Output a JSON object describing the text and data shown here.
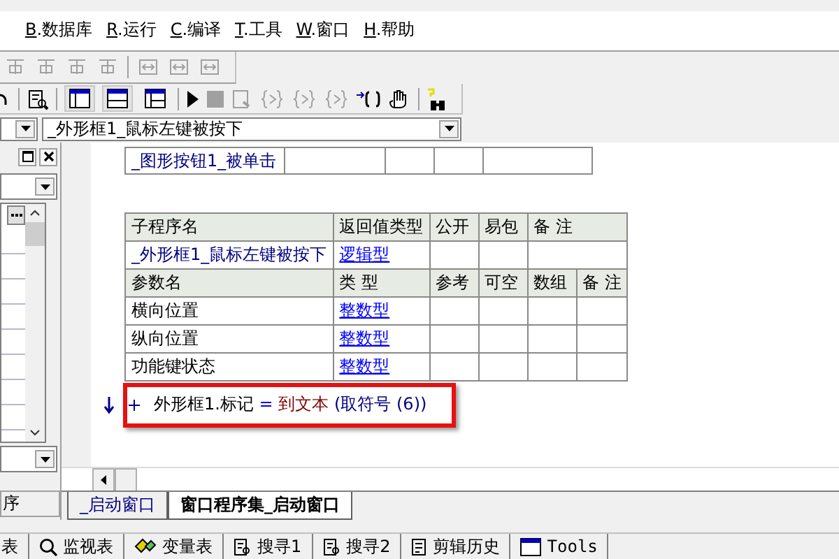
{
  "menu": [
    {
      "label": "B.数据库"
    },
    {
      "label": "R.运行"
    },
    {
      "label": "C.编译"
    },
    {
      "label": "T.工具"
    },
    {
      "label": "W.窗口"
    },
    {
      "label": "H.帮助"
    }
  ],
  "event_selector": {
    "value": "_外形框1_鼠标左键被按下"
  },
  "linked_event": {
    "name": "_图形按钮1_被单击"
  },
  "subroutine": {
    "header": [
      "子程序名",
      "返回值类型",
      "公开",
      "易包",
      "备 注"
    ],
    "name": "_外形框1_鼠标左键被按下",
    "return_type": "逻辑型",
    "param_header": [
      "参数名",
      "类 型",
      "参考",
      "可空",
      "数组",
      "备 注"
    ],
    "params": [
      {
        "name": "横向位置",
        "type": "整数型"
      },
      {
        "name": "纵向位置",
        "type": "整数型"
      },
      {
        "name": "功能键状态",
        "type": "整数型"
      }
    ]
  },
  "code_line": {
    "object": "外形框1.标记",
    "operator": "=",
    "function": "到文本",
    "argument": "(取符号 (6))",
    "highlighted": true
  },
  "left_panel": {
    "tab": "序"
  },
  "editor_tabs": [
    {
      "label": "_启动窗口",
      "selected": false
    },
    {
      "label": "窗口程序集_启动窗口",
      "selected": true
    }
  ],
  "bottom_tabs": [
    {
      "label": "表",
      "kind": "plain"
    },
    {
      "label": "监视表",
      "kind": "watch"
    },
    {
      "label": "变量表",
      "kind": "variables"
    },
    {
      "label": "搜寻1",
      "kind": "search"
    },
    {
      "label": "搜寻2",
      "kind": "search"
    },
    {
      "label": "剪辑历史",
      "kind": "history"
    },
    {
      "label": "Tools",
      "kind": "tools"
    }
  ]
}
